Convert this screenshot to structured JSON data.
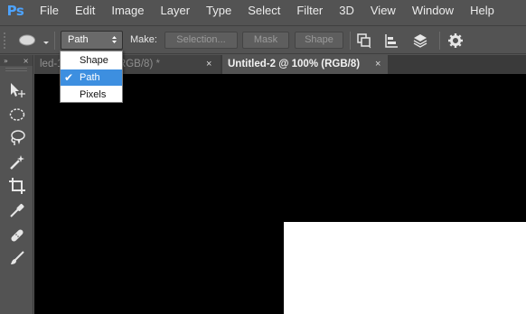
{
  "app": {
    "logo": "Ps"
  },
  "menu": [
    "File",
    "Edit",
    "Image",
    "Layer",
    "Type",
    "Select",
    "Filter",
    "3D",
    "View",
    "Window",
    "Help"
  ],
  "options": {
    "tool_preset_icon": "ellipse-preset-icon",
    "mode_value": "Path",
    "make_label": "Make:",
    "selection_label": "Selection...",
    "mask_label": "Mask",
    "shape_label": "Shape"
  },
  "dropdown": {
    "items": [
      "Shape",
      "Path",
      "Pixels"
    ],
    "selected": "Path",
    "check": "✔"
  },
  "tools_panel": {
    "collapse": "»",
    "close": "×",
    "tools": [
      "move-tool-icon",
      "elliptical-marquee-tool-icon",
      "lasso-tool-icon",
      "magic-wand-tool-icon",
      "crop-tool-icon",
      "eyedropper-tool-icon",
      "healing-brush-tool-icon",
      "brush-tool-icon"
    ]
  },
  "tabs": [
    {
      "label": "led-1... (Layer 3, RGB/8) *",
      "close": "×",
      "active": false
    },
    {
      "label": "Untitled-2 @ 100% (RGB/8)",
      "close": "×",
      "active": true
    }
  ],
  "colors": {
    "ui_bg": "#535353",
    "canvas": "#000000",
    "selected": "#3d8fe0",
    "logo": "#4da3ff"
  }
}
